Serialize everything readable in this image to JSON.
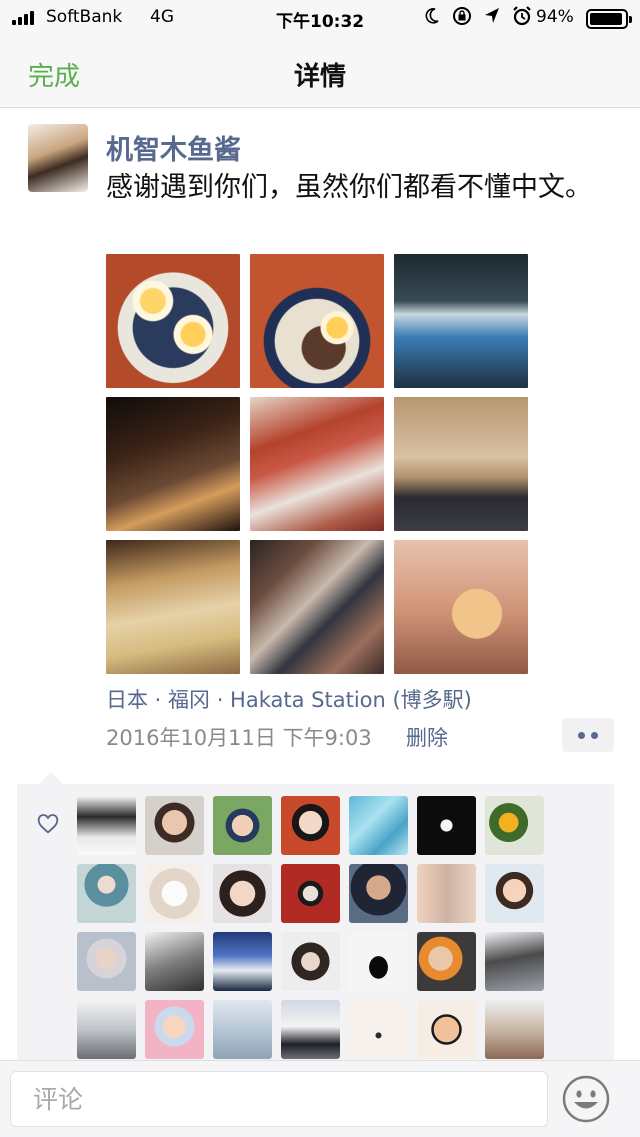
{
  "status_bar": {
    "carrier": "SoftBank",
    "network": "4G",
    "time": "下午10:32",
    "battery_percent": "94%",
    "battery_level": 0.94,
    "icons": [
      "moon-icon",
      "rotation-lock-icon",
      "location-icon",
      "alarm-icon"
    ]
  },
  "nav": {
    "done_label": "完成",
    "title": "详情"
  },
  "post": {
    "author": "机智木鱼酱",
    "text": "感谢遇到你们，虽然你们都看不懂中文。",
    "photos": [
      "ramen-photo-1",
      "ramen-photo-2",
      "boat-photo",
      "street-night-photo",
      "capsule-toy-photo",
      "room-photo",
      "tatami-room-photo",
      "poster-photo",
      "toy-figure-photo"
    ],
    "location": "日本 · 福冈 · Hakata Station (博多駅)",
    "timestamp": "2016年10月11日 下午9:03",
    "delete_label": "删除"
  },
  "likes": {
    "count_shown": 28
  },
  "comment": {
    "placeholder": "评论"
  },
  "colors": {
    "accent_green": "#57b04c",
    "link_blue": "#57698f",
    "panel_bg": "#f3f3f5"
  }
}
